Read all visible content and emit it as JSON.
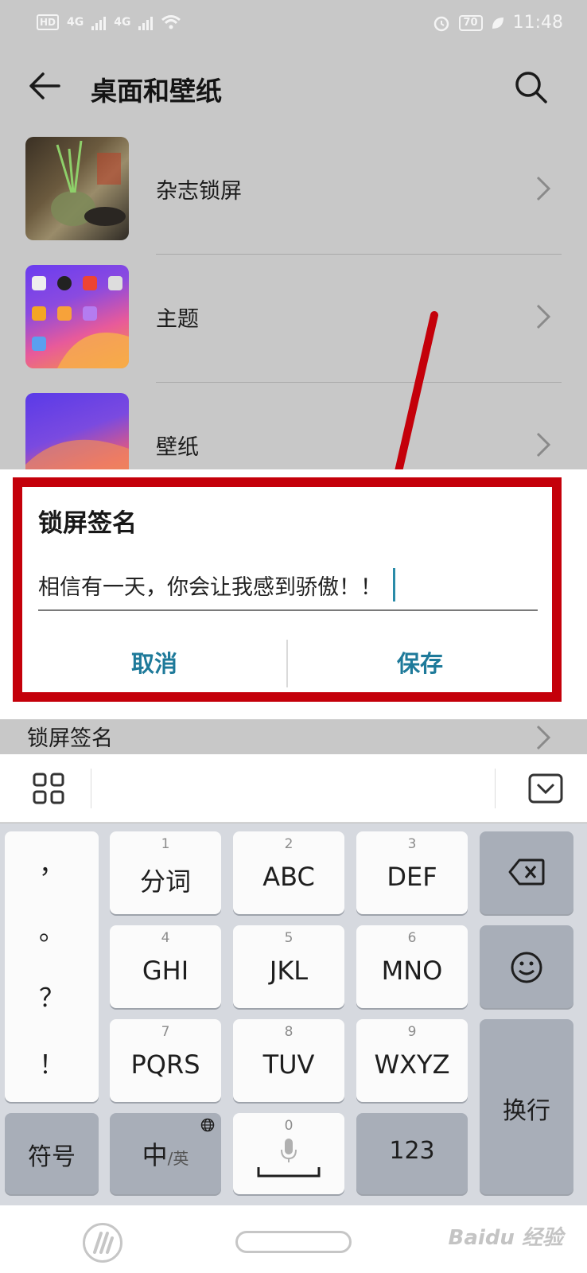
{
  "status_bar": {
    "hd": "HD",
    "network1": "4G",
    "network2": "4G",
    "battery": "70",
    "time": "11:48"
  },
  "app_bar": {
    "title": "桌面和壁纸"
  },
  "settings_list": [
    {
      "label": "杂志锁屏"
    },
    {
      "label": "主题"
    },
    {
      "label": "壁纸"
    }
  ],
  "dialog": {
    "title": "锁屏签名",
    "input_value": "相信有一天，你会让我感到骄傲！！",
    "cancel_label": "取消",
    "save_label": "保存"
  },
  "behind_item": {
    "label": "锁屏签名"
  },
  "keyboard": {
    "punctuation": [
      "，",
      "。",
      "？",
      "！"
    ],
    "keys": [
      {
        "num": "1",
        "label": "分词"
      },
      {
        "num": "2",
        "label": "ABC"
      },
      {
        "num": "3",
        "label": "DEF"
      },
      {
        "num": "4",
        "label": "GHI"
      },
      {
        "num": "5",
        "label": "JKL"
      },
      {
        "num": "6",
        "label": "MNO"
      },
      {
        "num": "7",
        "label": "PQRS"
      },
      {
        "num": "8",
        "label": "TUV"
      },
      {
        "num": "9",
        "label": "WXYZ"
      }
    ],
    "symbols_label": "符号",
    "lang_main": "中",
    "lang_alt": "/英",
    "space_num": "0",
    "num_mode_label": "123",
    "enter_label": "换行"
  },
  "watermark": "Baidu 经验",
  "colors": {
    "annotation_red": "#c4000a",
    "accent_blue": "#1e7a9a"
  }
}
